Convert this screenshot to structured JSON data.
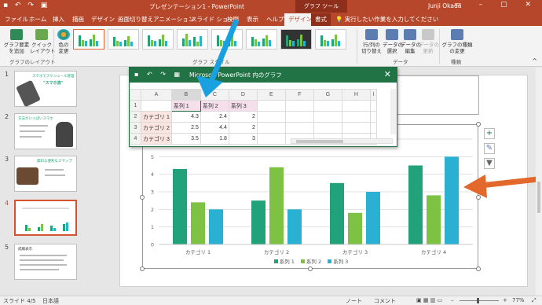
{
  "titlebar": {
    "doc_title": "プレゼンテーション1 - PowerPoint",
    "context_tab": "グラフ ツール",
    "user": "Junji Okada",
    "qat_icons": [
      "save-icon",
      "undo-icon",
      "redo-icon",
      "present-icon"
    ]
  },
  "tabs": [
    {
      "label": "ファイル"
    },
    {
      "label": "ホーム"
    },
    {
      "label": "挿入"
    },
    {
      "label": "描画"
    },
    {
      "label": "デザイン"
    },
    {
      "label": "画面切り替え"
    },
    {
      "label": "アニメーション"
    },
    {
      "label": "スライド ショー"
    },
    {
      "label": "校閲"
    },
    {
      "label": "表示"
    },
    {
      "label": "ヘルプ"
    },
    {
      "label": "デザイン"
    },
    {
      "label": "書式"
    }
  ],
  "tell_me": "実行したい作業を入力してください",
  "ribbon": {
    "add_element": "グラフ要素\nを追加",
    "quick_layout": "クイック\nレイアウト",
    "layout_group": "グラフのレイアウト",
    "change_color": "色の\n変更",
    "styles_group": "グラフ スタイル",
    "switch_row_col": "行/列の\n切り替え",
    "select_data": "データの\n選択",
    "edit_data": "データの\n編集",
    "refresh_data": "データの\n更新",
    "data_group": "データ",
    "change_type": "グラフの種類\nの変更",
    "type_group": "種類"
  },
  "thumbnails": [
    {
      "num": "1",
      "title": "スマホでスケジュール管理",
      "subtitle": "\"スマホ流\""
    },
    {
      "num": "2",
      "title": "方法がいっぱいスマホ"
    },
    {
      "num": "3",
      "title": "無料な便利なスマップ"
    },
    {
      "num": "4"
    },
    {
      "num": "5",
      "title": "成績表示"
    }
  ],
  "excel": {
    "title": "Microsoft PowerPoint 内のグラフ",
    "col_headers": [
      "",
      "A",
      "B",
      "C",
      "D",
      "E",
      "F",
      "G",
      "H",
      "I"
    ],
    "rows": [
      {
        "num": "1",
        "cells": [
          "",
          "系列 1",
          "系列 2",
          "系列 3"
        ]
      },
      {
        "num": "2",
        "cells": [
          "カテゴリ 1",
          "4.3",
          "2.4",
          "2"
        ]
      },
      {
        "num": "3",
        "cells": [
          "カテゴリ 2",
          "2.5",
          "4.4",
          "2"
        ]
      },
      {
        "num": "4",
        "cells": [
          "カテゴリ 3",
          "3.5",
          "1.8",
          "3"
        ]
      }
    ]
  },
  "status": {
    "slide_info": "スライド 4/5",
    "language": "日本語",
    "notes": "ノート",
    "comments": "コメント",
    "zoom": "77%"
  },
  "colors": {
    "accent": "#b7472a",
    "series1": "#21a27a",
    "series2": "#7dc243",
    "series3": "#2ab0d3",
    "arrow_blue": "#18a0e0",
    "arrow_orange": "#e2682c"
  },
  "chart_data": {
    "type": "bar",
    "categories": [
      "カテゴリ 1",
      "カテゴリ 2",
      "カテゴリ 3",
      "カテゴリ 4"
    ],
    "series": [
      {
        "name": "系列 1",
        "values": [
          4.3,
          2.5,
          3.5,
          4.5
        ]
      },
      {
        "name": "系列 2",
        "values": [
          2.4,
          4.4,
          1.8,
          2.8
        ]
      },
      {
        "name": "系列 3",
        "values": [
          2,
          2,
          3,
          5
        ]
      }
    ],
    "ylim": [
      0,
      6
    ],
    "yticks": [
      "0",
      "1",
      "2",
      "3",
      "4",
      "5",
      "6"
    ],
    "grid": true,
    "legend": "bottom"
  }
}
